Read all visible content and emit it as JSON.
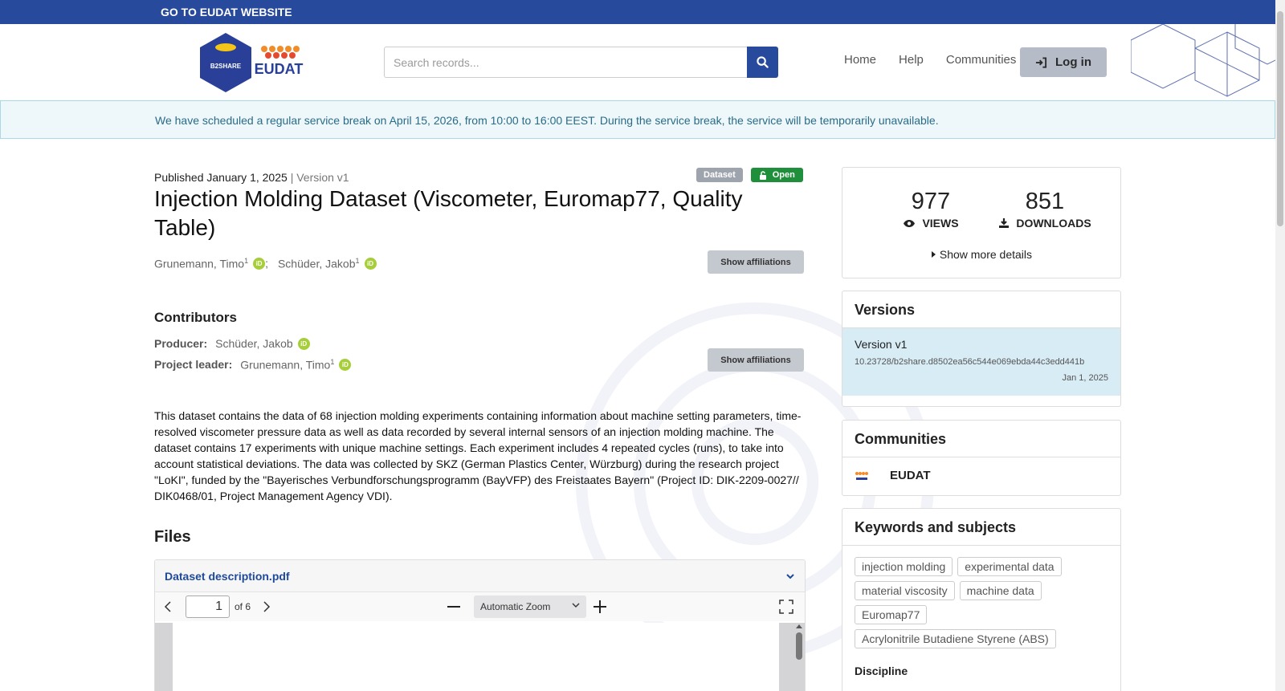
{
  "topbar": {
    "link_label": "GO TO EUDAT WEBSITE"
  },
  "header": {
    "logo_b2share_text": "B2SHARE",
    "logo_eudat_text": "EUDAT",
    "search_placeholder": "Search records...",
    "nav": [
      "Home",
      "Help",
      "Communities"
    ],
    "login_label": "Log in"
  },
  "banner": {
    "text": "We have scheduled a regular service break on April 15, 2026, from 10:00 to 16:00 EEST. During the service break, the service will be temporarily unavailable."
  },
  "record": {
    "published": "Published January 1, 2025",
    "version": "| Version v1",
    "badge_type": "Dataset",
    "badge_access": "Open",
    "title": "Injection Molding Dataset (Viscometer, Euromap77, Quality Table)",
    "creators": [
      {
        "name": "Grunemann, Timo",
        "sup": "1",
        "sep": ";"
      },
      {
        "name": "Schüder, Jakob",
        "sup": "1",
        "sep": ""
      }
    ],
    "show_affiliations": "Show affiliations",
    "contributors_heading": "Contributors",
    "contributors": [
      {
        "role": "Producer:",
        "name": "Schüder, Jakob",
        "sup": ""
      },
      {
        "role": "Project leader:",
        "name": "Grunemann, Timo",
        "sup": "1"
      }
    ],
    "description": "This dataset contains the data of 68 injection molding experiments containing information about machine setting parameters, time-resolved viscometer pressure data as well as data recorded by several internal sensors of an injection molding machine. The dataset contains 17 experiments with unique machine settings. Each experiment includes 4 repeated cycles (runs), to take into account statistical deviations. The data was collected by SKZ (German Plastics Center, Würzburg) during the research project \"LoKI\", funded by the \"Bayerisches Verbundforschungsprogramm (BayVFP) des Freistaates Bayern\" (Project ID: DIK-2209-0027// DIK0468/01, Project Management Agency VDI).",
    "files_heading": "Files",
    "file_name": "Dataset description.pdf",
    "viewer": {
      "page": "1",
      "of_pages": "of 6",
      "zoom": "Automatic Zoom"
    }
  },
  "stats": {
    "views": "977",
    "views_label": "VIEWS",
    "downloads": "851",
    "downloads_label": "DOWNLOADS",
    "more_label": "Show more details"
  },
  "versions": {
    "heading": "Versions",
    "label": "Version v1",
    "doi": "10.23728/b2share.d8502ea56c544e069ebda44c3edd441b",
    "date": "Jan 1, 2025"
  },
  "communities": {
    "heading": "Communities",
    "name": "EUDAT"
  },
  "keywords": {
    "heading": "Keywords and subjects",
    "tags": [
      "injection molding",
      "experimental data",
      "material viscosity",
      "machine data",
      "Euromap77",
      "Acrylonitrile Butadiene Styrene (ABS)"
    ],
    "discipline_heading": "Discipline"
  },
  "colors": {
    "brand_blue": "#284a9c",
    "open_green": "#1f8f3b",
    "banner_bg": "#eef8fb"
  }
}
